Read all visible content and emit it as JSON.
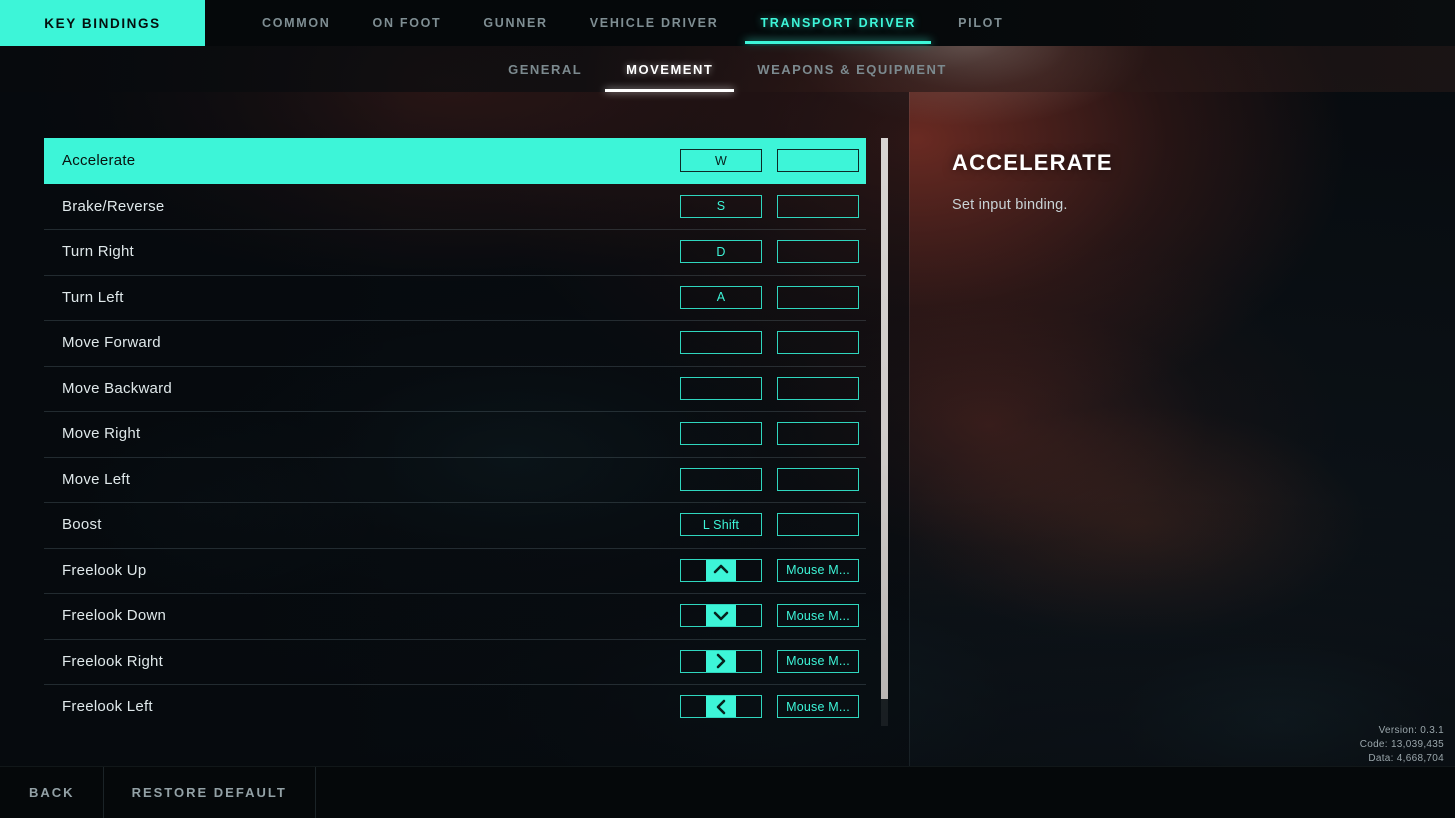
{
  "topnav": {
    "brand_tab": "KEY BINDINGS",
    "items": [
      {
        "label": "COMMON",
        "active": false
      },
      {
        "label": "ON FOOT",
        "active": false
      },
      {
        "label": "GUNNER",
        "active": false
      },
      {
        "label": "VEHICLE DRIVER",
        "active": false
      },
      {
        "label": "TRANSPORT DRIVER",
        "active": true
      },
      {
        "label": "PILOT",
        "active": false
      }
    ]
  },
  "subnav": {
    "items": [
      {
        "label": "GENERAL",
        "active": false
      },
      {
        "label": "MOVEMENT",
        "active": true
      },
      {
        "label": "WEAPONS & EQUIPMENT",
        "active": false
      }
    ]
  },
  "bindings": {
    "rows": [
      {
        "action": "Accelerate",
        "primary": "W",
        "secondary": "",
        "selected": true,
        "primary_icon": "",
        "secondary_icon": ""
      },
      {
        "action": "Brake/Reverse",
        "primary": "S",
        "secondary": "",
        "selected": false,
        "primary_icon": "",
        "secondary_icon": ""
      },
      {
        "action": "Turn Right",
        "primary": "D",
        "secondary": "",
        "selected": false,
        "primary_icon": "",
        "secondary_icon": ""
      },
      {
        "action": "Turn Left",
        "primary": "A",
        "secondary": "",
        "selected": false,
        "primary_icon": "",
        "secondary_icon": ""
      },
      {
        "action": "Move Forward",
        "primary": "",
        "secondary": "",
        "selected": false,
        "primary_icon": "",
        "secondary_icon": ""
      },
      {
        "action": "Move Backward",
        "primary": "",
        "secondary": "",
        "selected": false,
        "primary_icon": "",
        "secondary_icon": ""
      },
      {
        "action": "Move Right",
        "primary": "",
        "secondary": "",
        "selected": false,
        "primary_icon": "",
        "secondary_icon": ""
      },
      {
        "action": "Move Left",
        "primary": "",
        "secondary": "",
        "selected": false,
        "primary_icon": "",
        "secondary_icon": ""
      },
      {
        "action": "Boost",
        "primary": "L Shift",
        "secondary": "",
        "selected": false,
        "primary_icon": "",
        "secondary_icon": ""
      },
      {
        "action": "Freelook Up",
        "primary": "",
        "secondary": "Mouse M...",
        "selected": false,
        "primary_icon": "chevron-up-icon",
        "secondary_icon": ""
      },
      {
        "action": "Freelook Down",
        "primary": "",
        "secondary": "Mouse M...",
        "selected": false,
        "primary_icon": "chevron-down-icon",
        "secondary_icon": ""
      },
      {
        "action": "Freelook Right",
        "primary": "",
        "secondary": "Mouse M...",
        "selected": false,
        "primary_icon": "chevron-right-icon",
        "secondary_icon": ""
      },
      {
        "action": "Freelook Left",
        "primary": "",
        "secondary": "Mouse M...",
        "selected": false,
        "primary_icon": "chevron-left-icon",
        "secondary_icon": ""
      }
    ]
  },
  "detail": {
    "title": "ACCELERATE",
    "description": "Set input binding."
  },
  "build": {
    "version": "Version: 0.3.1",
    "code": "Code: 13,039,435",
    "data": "Data: 4,668,704"
  },
  "bottombar": {
    "back": "BACK",
    "restore_default": "RESTORE DEFAULT"
  },
  "colors": {
    "accent": "#3df5d8",
    "accent_border": "#2fd6be",
    "text_primary": "#dfe8ea",
    "text_muted": "#7f8e93",
    "bg_dark": "#05080a",
    "scrollbar_thumb": "#d0ccca"
  }
}
